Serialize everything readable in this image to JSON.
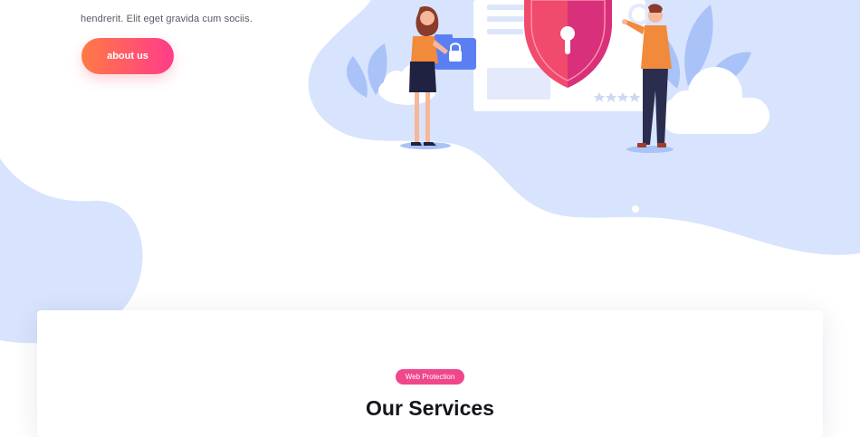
{
  "hero": {
    "body_text": "hendrerit. Elit eget gravida cum sociis.",
    "about_button_label": "about us"
  },
  "illustration": {
    "shield": "shield-keyhole-icon",
    "folder": "folder-lock-icon",
    "rating_stars": "stars-icon",
    "rating": 4
  },
  "services": {
    "badge_label": "Web Protection",
    "title": "Our Services"
  },
  "colors": {
    "accent_start": "#ff7a45",
    "accent_end": "#ff3b8a",
    "badge": "#f0468c",
    "blob": "#d8e4fd",
    "shield": "#f04a6c",
    "title": "#14141c"
  }
}
